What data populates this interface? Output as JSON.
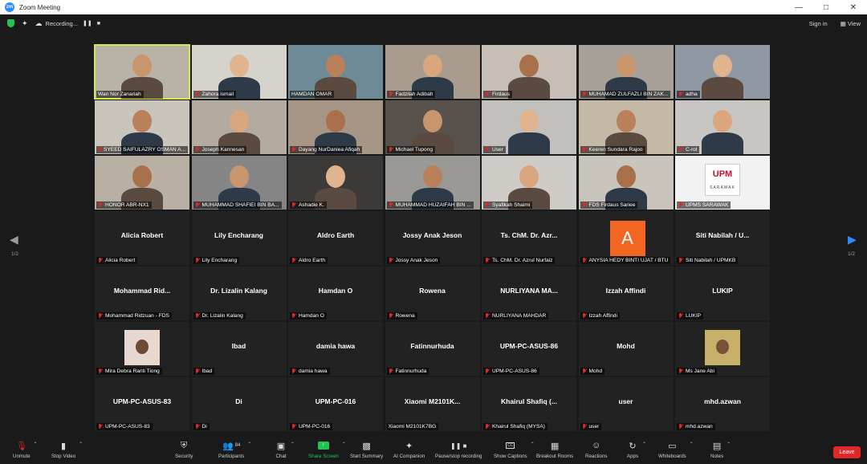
{
  "window": {
    "title": "Zoom Meeting",
    "logo_text": "zm"
  },
  "topbar": {
    "recording_label": "Recording...",
    "signin_label": "Sign in",
    "view_label": "View"
  },
  "pager": {
    "left_indicator": "1/2",
    "right_indicator": "1/2"
  },
  "avatar_letter": "A",
  "colors": {
    "active_border": "#d4e84a",
    "leave": "#e02828",
    "share": "#23c552",
    "avatar_orange": "#f26522"
  },
  "tiles": [
    {
      "label": "Wan Nor Zanariah",
      "big": "",
      "video": true,
      "muted": false,
      "active": true
    },
    {
      "label": "Zahora ismail",
      "big": "",
      "video": true,
      "muted": true
    },
    {
      "label": "HAMDAN OMAR",
      "big": "",
      "video": true,
      "muted": false
    },
    {
      "label": "Fadzilah Adibah",
      "big": "",
      "video": true,
      "muted": true
    },
    {
      "label": "Firdaus",
      "big": "",
      "video": true,
      "muted": true
    },
    {
      "label": "MUHAMAD ZULFAZLI BIN ZAK...",
      "big": "",
      "video": true,
      "muted": true
    },
    {
      "label": "adha",
      "big": "",
      "video": true,
      "muted": true
    },
    {
      "label": "SYEED SAIFULAZRY OSMAN A...",
      "big": "",
      "video": true,
      "muted": true
    },
    {
      "label": "Joseph Kannesan",
      "big": "",
      "video": true,
      "muted": true
    },
    {
      "label": "Dayang NurDaniea Afiqah",
      "big": "",
      "video": true,
      "muted": true
    },
    {
      "label": "Michael Tupong",
      "big": "",
      "video": true,
      "muted": true
    },
    {
      "label": "User",
      "big": "",
      "video": true,
      "muted": true
    },
    {
      "label": "Keeren Sundara Rajoo",
      "big": "",
      "video": true,
      "muted": true
    },
    {
      "label": "C-rol",
      "big": "",
      "video": true,
      "muted": true
    },
    {
      "label": "HONOR ABR-NX1",
      "big": "",
      "video": true,
      "muted": true
    },
    {
      "label": "MUHAMMAD SHAFIEI BIN BA...",
      "big": "",
      "video": true,
      "muted": true
    },
    {
      "label": "Ashadie K.",
      "big": "",
      "video": true,
      "muted": true
    },
    {
      "label": "MUHAMMAD HUZAIFAH BIN ...",
      "big": "",
      "video": true,
      "muted": true
    },
    {
      "label": "Syafikah Shaimi",
      "big": "",
      "video": true,
      "muted": true
    },
    {
      "label": "FDS Firdaus Sariee",
      "big": "",
      "video": true,
      "muted": true
    },
    {
      "label": "UPMS SARAWAK",
      "big": "",
      "video": true,
      "muted": true,
      "logo": "UPM",
      "logo_sub": "SARAWAK"
    },
    {
      "label": "Alicia Robert",
      "big": "Alicia Robert",
      "video": false,
      "muted": true
    },
    {
      "label": "Lily Encharang",
      "big": "Lily Encharang",
      "video": false,
      "muted": true
    },
    {
      "label": "Aldro Earth",
      "big": "Aldro Earth",
      "video": false,
      "muted": true
    },
    {
      "label": "Jossy Anak Jeson",
      "big": "Jossy Anak Jeson",
      "video": false,
      "muted": true
    },
    {
      "label": "Ts. ChM. Dr. Azrul Nurfaiz",
      "big": "Ts. ChM. Dr. Azr...",
      "video": false,
      "muted": true
    },
    {
      "label": "ANYSIA HEDY BINTI UJAT / BTU",
      "big": "",
      "video": false,
      "muted": true,
      "avatar": true
    },
    {
      "label": "Siti Nabilah / UPMKB",
      "big": "Siti Nabilah / U...",
      "video": false,
      "muted": true
    },
    {
      "label": "Mohammad Ridzuan - FDS",
      "big": "Mohammad  Rid...",
      "video": false,
      "muted": true
    },
    {
      "label": "Dr. Lizalin Kalang",
      "big": "Dr. Lizalin Kalang",
      "video": false,
      "muted": true
    },
    {
      "label": "Hamdan O",
      "big": "Hamdan O",
      "video": false,
      "muted": true
    },
    {
      "label": "Rowena",
      "big": "Rowena",
      "video": false,
      "muted": true
    },
    {
      "label": "NURLIYANA MAHDAR",
      "big": "NURLIYANA MA...",
      "video": false,
      "muted": true
    },
    {
      "label": "Izzah Affindi",
      "big": "Izzah Affindi",
      "video": false,
      "muted": true
    },
    {
      "label": "LUKIP",
      "big": "LUKIP",
      "video": false,
      "muted": true
    },
    {
      "label": "Mira Debra Ranti Tiong",
      "big": "",
      "video": false,
      "muted": true,
      "photo": "butterfly"
    },
    {
      "label": "Ibad",
      "big": "Ibad",
      "video": false,
      "muted": true
    },
    {
      "label": "damia hawa",
      "big": "damia hawa",
      "video": false,
      "muted": true
    },
    {
      "label": "Fatinnurhuda",
      "big": "Fatinnurhuda",
      "video": false,
      "muted": true
    },
    {
      "label": "UPM-PC-ASUS-86",
      "big": "UPM-PC-ASUS-86",
      "video": false,
      "muted": true
    },
    {
      "label": "Mohd",
      "big": "Mohd",
      "video": false,
      "muted": true
    },
    {
      "label": "Ms Jane Abi",
      "big": "",
      "video": false,
      "muted": true,
      "photo": "person"
    },
    {
      "label": "UPM-PC-ASUS-83",
      "big": "UPM-PC-ASUS-83",
      "video": false,
      "muted": true
    },
    {
      "label": "Di",
      "big": "Di",
      "video": false,
      "muted": true
    },
    {
      "label": "UPM-PC-016",
      "big": "UPM-PC-016",
      "video": false,
      "muted": true
    },
    {
      "label": "Xiaomi M2101K7BG",
      "big": "Xiaomi  M2101K...",
      "video": false,
      "muted": false
    },
    {
      "label": "Khairul Shafiq (MYSA)",
      "big": "Khairul Shafiq (...",
      "video": false,
      "muted": true
    },
    {
      "label": "user",
      "big": "user",
      "video": false,
      "muted": true
    },
    {
      "label": "mhd.azwan",
      "big": "mhd.azwan",
      "video": false,
      "muted": true
    }
  ],
  "toolbar": {
    "unmute": "Unmute",
    "stop_video": "Stop Video",
    "security": "Security",
    "participants": "Participants",
    "participants_count": "84",
    "chat": "Chat",
    "share_screen": "Share Screen",
    "start_summary": "Start Summary",
    "ai_companion": "AI Companion",
    "pause_recording": "Pause/stop recording",
    "show_captions": "Show Captions",
    "breakout_rooms": "Breakout Rooms",
    "reactions": "Reactions",
    "apps": "Apps",
    "whiteboards": "Whiteboards",
    "notes": "Notes",
    "leave": "Leave"
  }
}
